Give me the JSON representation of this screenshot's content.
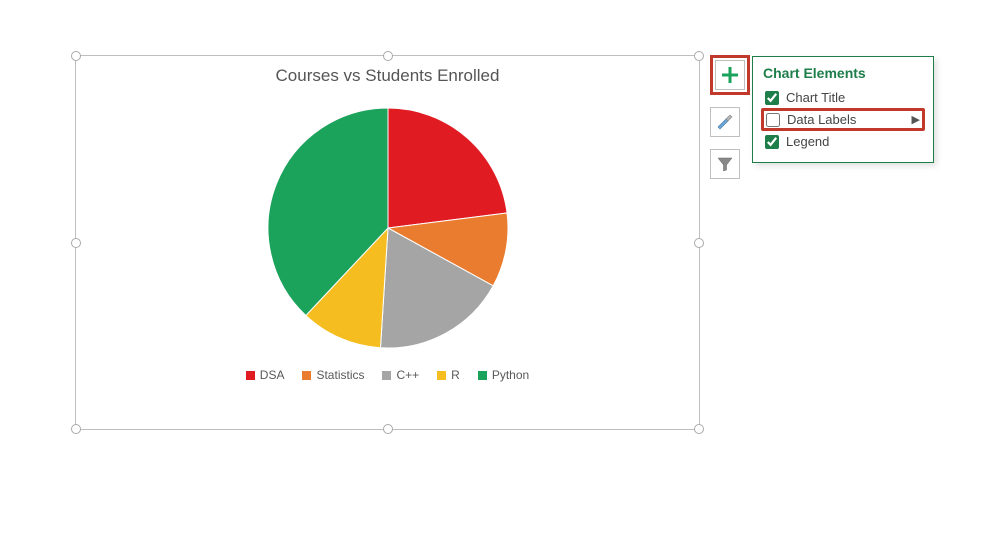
{
  "chart_data": {
    "type": "pie",
    "title": "Courses vs Students Enrolled",
    "categories": [
      "DSA",
      "Statistics",
      "C++",
      "R",
      "Python"
    ],
    "values": [
      23,
      10,
      18,
      11,
      38
    ],
    "colors": [
      "#e11b22",
      "#e97c2f",
      "#a5a5a5",
      "#f5bd1f",
      "#1ba25b"
    ]
  },
  "legend": {
    "items": [
      {
        "label": "DSA",
        "color": "#e11b22"
      },
      {
        "label": "Statistics",
        "color": "#e97c2f"
      },
      {
        "label": "C++",
        "color": "#a5a5a5"
      },
      {
        "label": "R",
        "color": "#f5bd1f"
      },
      {
        "label": "Python",
        "color": "#1ba25b"
      }
    ]
  },
  "side_tools": {
    "plus_icon": "plus-icon",
    "brush_icon": "brush-icon",
    "filter_icon": "filter-icon"
  },
  "flyout": {
    "title": "Chart Elements",
    "items": [
      {
        "label": "Chart Title",
        "checked": true,
        "has_submenu": false
      },
      {
        "label": "Data Labels",
        "checked": false,
        "has_submenu": true
      },
      {
        "label": "Legend",
        "checked": true,
        "has_submenu": false
      }
    ]
  }
}
